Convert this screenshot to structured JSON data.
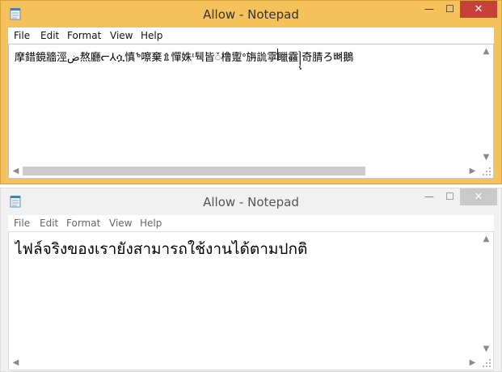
{
  "windows": [
    {
      "title": "Allow - Notepad",
      "controls": {
        "minimize": "—",
        "maximize": "☐",
        "close": "✕"
      },
      "menu": [
        "File",
        "Edit",
        "Format",
        "View",
        "Help"
      ],
      "content": "摩錯鏡牆涇ض熬廳ᓕ⅄ሷ慎ᕻ嚓棄⇭憚姝ᶦ퉥皆ᮨ橹躗ᐤ旃詤雽䁽靃꧍奇腈ろ뼈鵝",
      "scroll_position": 0.72,
      "active": true
    },
    {
      "title": "Allow - Notepad",
      "controls": {
        "minimize": "—",
        "maximize": "☐",
        "close": "✕"
      },
      "menu": [
        "File",
        "Edit",
        "Format",
        "View",
        "Help"
      ],
      "content": "ไฟล์จริงของเรายังสามารถใช้งานได้ตามปกติ",
      "active": false
    }
  ],
  "colors": {
    "active_frame": "#f4c15a",
    "inactive_frame": "#f1f1f1",
    "close_active": "#c7413a"
  },
  "icons": [
    "notepad-icon",
    "minimize-icon",
    "maximize-icon",
    "close-icon",
    "chevron-up-icon",
    "chevron-down-icon",
    "chevron-left-icon",
    "chevron-right-icon"
  ]
}
